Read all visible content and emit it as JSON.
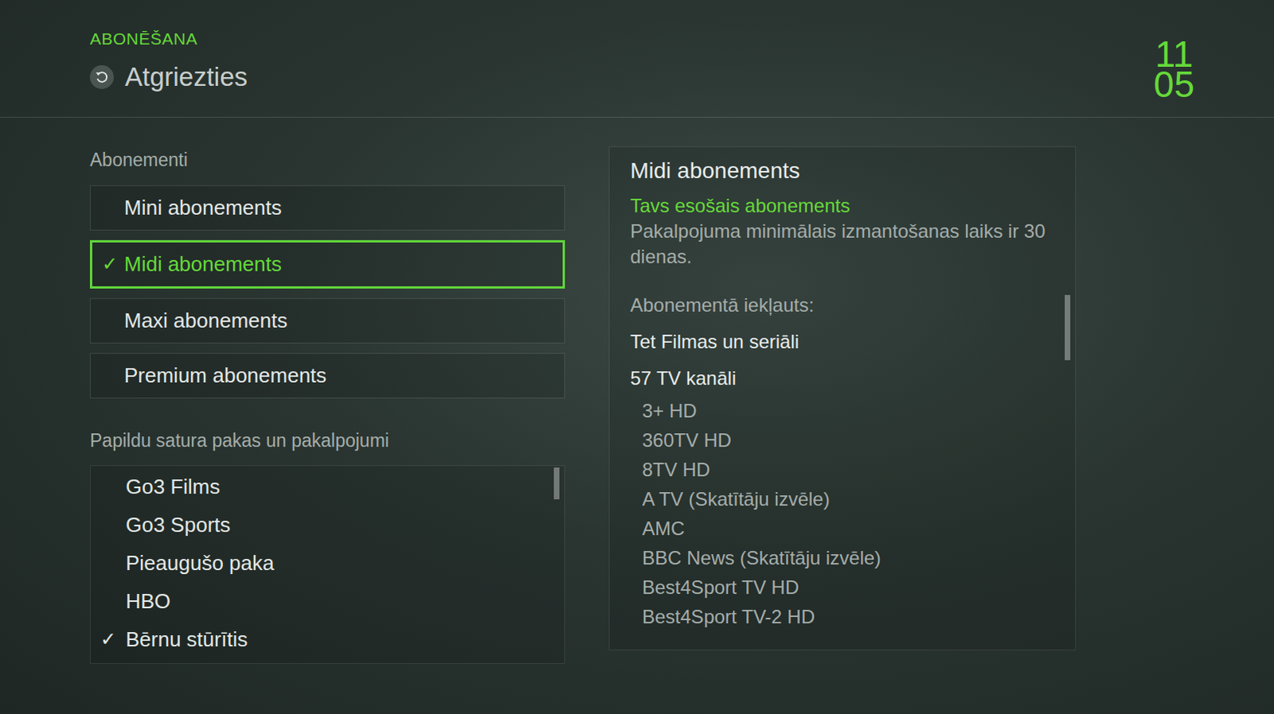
{
  "header": {
    "section": "ABONĒŠANA",
    "back": "Atgriezties",
    "clock": {
      "hours": "11",
      "minutes": "05"
    }
  },
  "subscriptions": {
    "heading": "Abonementi",
    "check_mark": "✓",
    "items": [
      {
        "label": "Mini abonements",
        "selected": false,
        "checked": false
      },
      {
        "label": "Midi abonements",
        "selected": true,
        "checked": true
      },
      {
        "label": "Maxi abonements",
        "selected": false,
        "checked": false
      },
      {
        "label": "Premium abonements",
        "selected": false,
        "checked": false
      }
    ]
  },
  "addons": {
    "heading": "Papildu satura pakas un pakalpojumi",
    "check_mark": "✓",
    "items": [
      {
        "label": "Go3 Films",
        "checked": false
      },
      {
        "label": "Go3 Sports",
        "checked": false
      },
      {
        "label": "Pieaugušo paka",
        "checked": false
      },
      {
        "label": "HBO",
        "checked": false
      },
      {
        "label": "Bērnu stūrītis",
        "checked": true
      }
    ]
  },
  "details": {
    "title": "Midi abonements",
    "status": "Tavs esošais abonements",
    "note": "Pakalpojuma minimālais izmantošanas laiks ir 30 dienas.",
    "included_heading": "Abonementā iekļauts:",
    "included": [
      "Tet Filmas un seriāli",
      "57 TV kanāli"
    ],
    "channels": [
      "3+ HD",
      "360TV HD",
      "8TV HD",
      "A TV (Skatītāju izvēle)",
      "AMC",
      "BBC News (Skatītāju izvēle)",
      "Best4Sport TV HD",
      "Best4Sport TV-2 HD"
    ]
  }
}
